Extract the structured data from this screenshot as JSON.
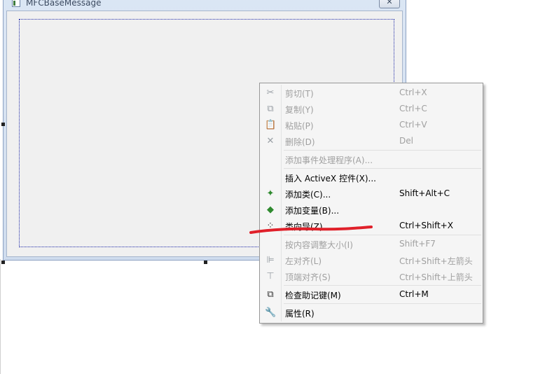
{
  "dialog": {
    "title": "MFCBaseMessage",
    "close_label": "✕"
  },
  "menu": {
    "items": [
      {
        "icon": "✂",
        "label": "剪切(T)",
        "shortcut": "Ctrl+X",
        "enabled": false
      },
      {
        "icon": "⧉",
        "label": "复制(Y)",
        "shortcut": "Ctrl+C",
        "enabled": false
      },
      {
        "icon": "📋",
        "label": "粘贴(P)",
        "shortcut": "Ctrl+V",
        "enabled": false
      },
      {
        "icon": "✕",
        "label": "删除(D)",
        "shortcut": "Del",
        "enabled": false
      },
      {
        "icon": "",
        "label": "添加事件处理程序(A)...",
        "shortcut": "",
        "enabled": false
      },
      {
        "icon": "",
        "label": "插入 ActiveX 控件(X)...",
        "shortcut": "",
        "enabled": true
      },
      {
        "icon": "✦",
        "label": "添加类(C)...",
        "shortcut": "Shift+Alt+C",
        "enabled": true
      },
      {
        "icon": "◆",
        "label": "添加变量(B)...",
        "shortcut": "",
        "enabled": true
      },
      {
        "icon": "⁘",
        "label": "类向导(Z)...",
        "shortcut": "Ctrl+Shift+X",
        "enabled": true
      },
      {
        "icon": "",
        "label": "按内容调整大小(I)",
        "shortcut": "Shift+F7",
        "enabled": false
      },
      {
        "icon": "⊫",
        "label": "左对齐(L)",
        "shortcut": "Ctrl+Shift+左箭头",
        "enabled": false
      },
      {
        "icon": "⊤",
        "label": "顶端对齐(S)",
        "shortcut": "Ctrl+Shift+上箭头",
        "enabled": false
      },
      {
        "icon": "⧉",
        "label": "检查助记键(M)",
        "shortcut": "Ctrl+M",
        "enabled": true
      },
      {
        "icon": "🔧",
        "label": "属性(R)",
        "shortcut": "",
        "enabled": true
      }
    ]
  },
  "colors": {
    "annotation": "#e0202a"
  }
}
